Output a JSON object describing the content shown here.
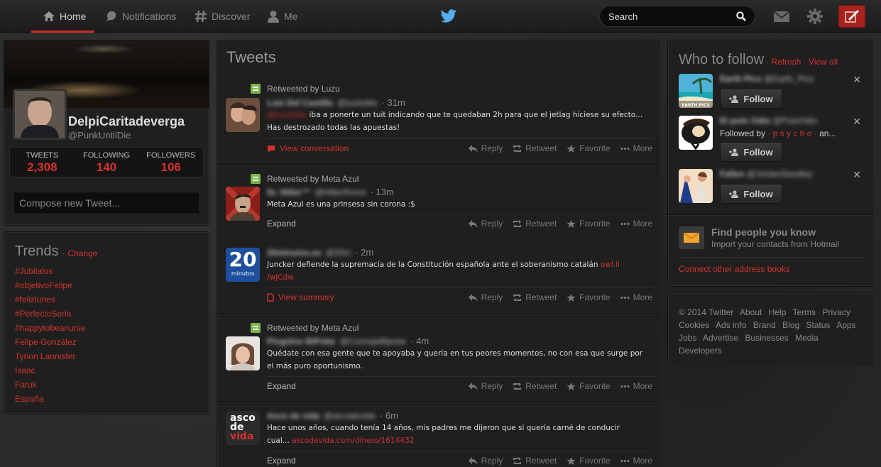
{
  "nav": {
    "home": "Home",
    "notifications": "Notifications",
    "discover": "Discover",
    "me": "Me",
    "search_placeholder": "Search"
  },
  "colors": {
    "accent": "#d2322d",
    "retweet_green": "#7ab648",
    "topbar": "#1c1c1c"
  },
  "profile": {
    "name": "DelpiCaritadeverga",
    "handle": "@PunkUntilDie",
    "stats": [
      {
        "label": "TWEETS",
        "value": "2,308"
      },
      {
        "label": "FOLLOWING",
        "value": "140"
      },
      {
        "label": "FOLLOWERS",
        "value": "106"
      }
    ],
    "compose_placeholder": "Compose new Tweet..."
  },
  "trends": {
    "title": "Trends",
    "change": "· Change",
    "items": [
      "#Jubilalos",
      "#objetivoFelipe",
      "#felizlunes",
      "#PerfectoSeria",
      "#happytobeanurse",
      "Felipe González",
      "Tyrion Lannister",
      "Isaac",
      "Faruk",
      "España"
    ]
  },
  "timeline": {
    "title": "Tweets",
    "actions": {
      "reply": "Reply",
      "retweet": "Retweet",
      "favorite": "Favorite",
      "more": "More"
    },
    "tweets": [
      {
        "retweeted_by": "Retweeted by Luzu",
        "name": "Luis Del Castillo",
        "handle": "@luzbelito",
        "time": "· 31m",
        "mention": "@luzutube",
        "text": "iba a ponerte un tuit indicando que te quedaban 2h para que el jetlag hiciese su efecto... Has destrozado todas las apuestas!",
        "footer": "View conversation"
      },
      {
        "retweeted_by": "Retweeted by Meta Azul",
        "name": "Sr. Hitler™",
        "handle": "@HitlerRomo",
        "time": "· 13m",
        "text": "Meta Azul es una prinsesa sin corona :$",
        "footer": "Expand"
      },
      {
        "name": "20minutos.es",
        "handle": "@20m",
        "time": "· 2m",
        "text": "Juncker defiende la supremacía de la Constitución española ante el soberanismo catalán",
        "link": "owl.li /wJCdw",
        "avatar_text": "20",
        "avatar_sub": "minutos",
        "footer": "View summary"
      },
      {
        "retweeted_by": "Retweeted by Meta Azul",
        "name": "Pingüino BiPolar",
        "handle": "@ConsejeBipolar",
        "time": "· 4m",
        "text": "Quédate con esa gente que te apoyaba y quería en tus peores momentos, no con esa que surge por el más puro oportunismo.",
        "footer": "Expand"
      },
      {
        "name": "Asco de vida",
        "handle": "@ascodevida",
        "time": "· 6m",
        "text": "Hace unos años, cuando tenía 14 años, mis padres me dijeron que si quería carné de conducir cual...",
        "link": "ascodevida.com/dinero/1614432",
        "avatar_lines": [
          "asco",
          "de",
          "vida"
        ],
        "footer": "Expand"
      }
    ]
  },
  "who_to_follow": {
    "title": "Who to follow",
    "refresh": "· Refresh",
    "view_all": "· View all",
    "follow_label": "Follow",
    "suggestions": [
      {
        "name": "Earth Pics",
        "handle": "@Earth_Pics",
        "avatar_text": "EARTH PICS"
      },
      {
        "name": "El puto Odio",
        "handle": "@PutoOdio",
        "followed_by_prefix": "Followed by",
        "followed_by_name": "· p s y c h o ·",
        "followed_by_suffix": "an..."
      },
      {
        "name": "Fallen",
        "handle": "@JordanSandley"
      }
    ],
    "find_title": "Find people you know",
    "find_sub": "Import your contacts from Hotmail",
    "connect": "Connect other address books"
  },
  "footer": {
    "links": [
      "© 2014 Twitter",
      "About",
      "Help",
      "Terms",
      "Privacy",
      "Cookies",
      "Ads info",
      "Brand",
      "Blog",
      "Status",
      "Apps",
      "Jobs",
      "Advertise",
      "Businesses",
      "Media",
      "Developers"
    ]
  }
}
